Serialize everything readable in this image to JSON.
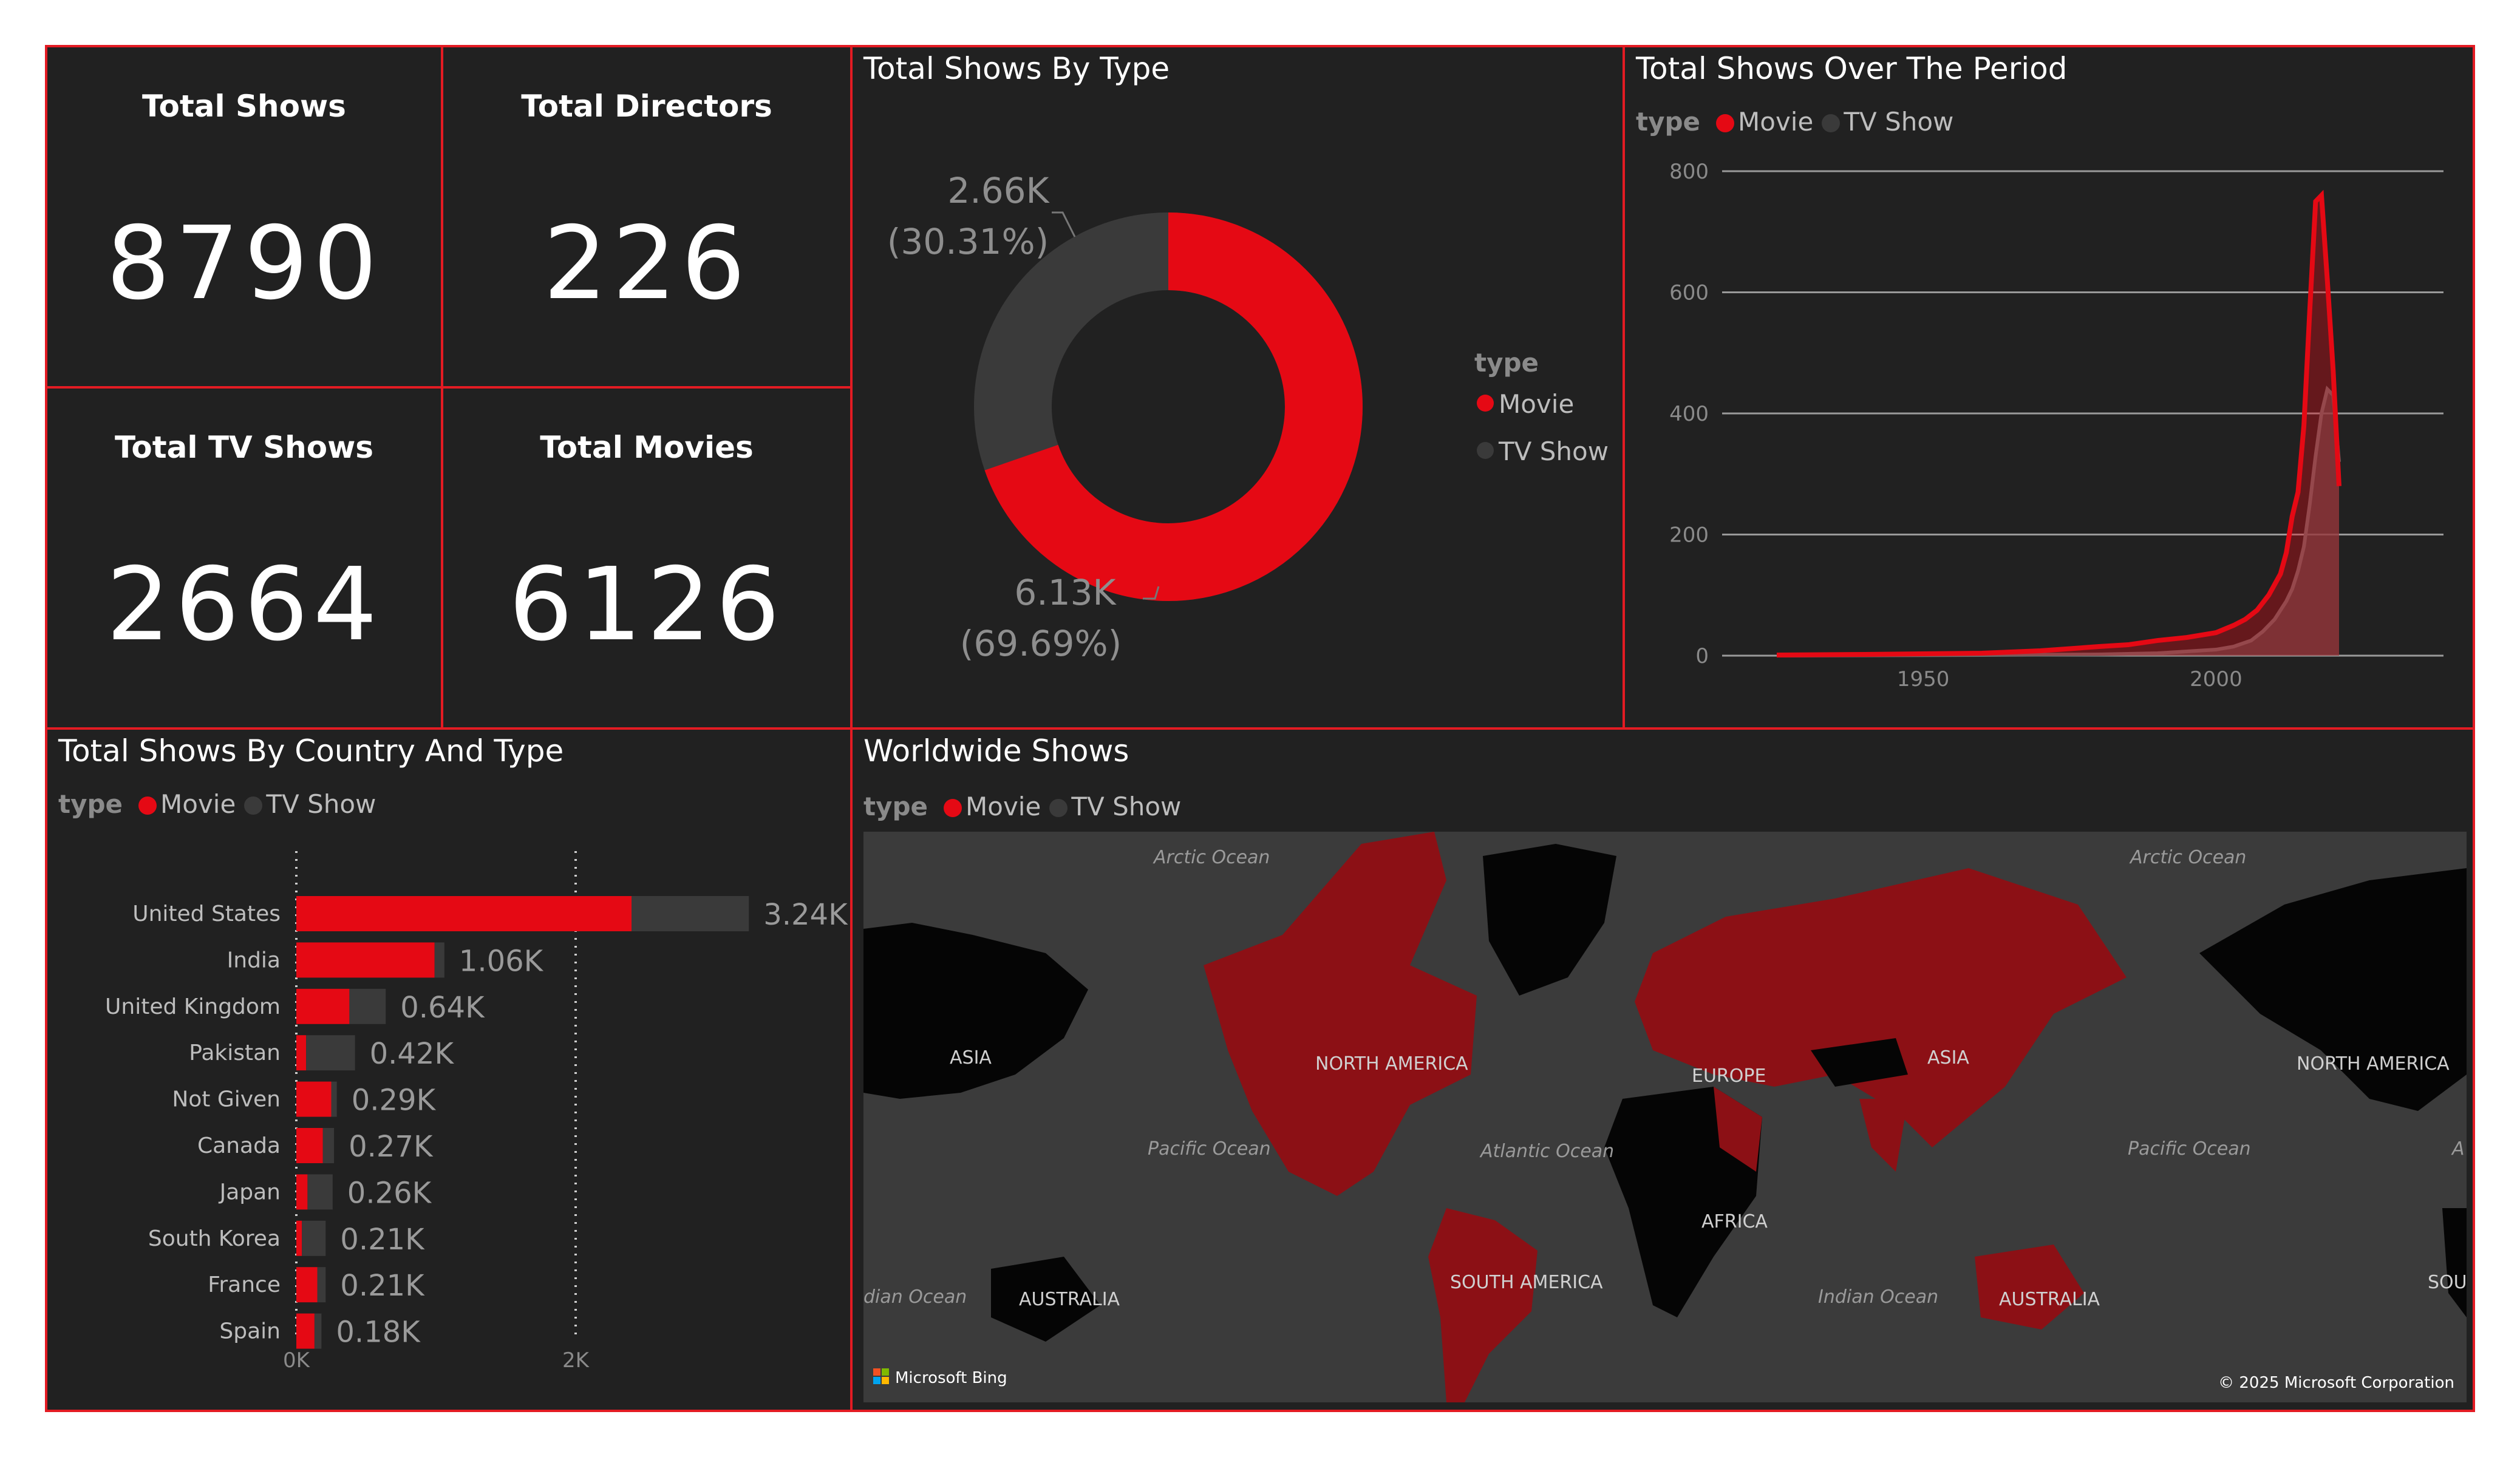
{
  "colors": {
    "movie": "#e50914",
    "tv_show": "#3a3a3a",
    "border": "#e31b23",
    "panel_bg": "#212121"
  },
  "kpis": {
    "total_shows": {
      "label": "Total Shows",
      "value": "8790"
    },
    "total_directors": {
      "label": "Total Directors",
      "value": "226"
    },
    "total_tv_shows": {
      "label": "Total TV Shows",
      "value": "2664"
    },
    "total_movies": {
      "label": "Total Movies",
      "value": "6126"
    }
  },
  "legend": {
    "title": "type",
    "movie": "Movie",
    "tv_show": "TV Show"
  },
  "donut": {
    "title": "Total Shows By Type",
    "tv_label": "2.66K",
    "tv_pct": "(30.31%)",
    "movie_label": "6.13K",
    "movie_pct": "(69.69%)"
  },
  "period": {
    "title": "Total Shows Over The Period"
  },
  "country": {
    "title": "Total Shows By Country And Type"
  },
  "map": {
    "title": "Worldwide Shows",
    "attribution": "Microsoft Bing",
    "copyright": "© 2025 Microsoft Corporation",
    "labels": {
      "arctic_left": "Arctic Ocean",
      "arctic_right": "Arctic Ocean",
      "asia_left": "ASIA",
      "north_america": "NORTH AMERICA",
      "europe": "EUROPE",
      "asia": "ASIA",
      "north_america_right": "NORTH AMERICA",
      "pacific_left": "Pacific Ocean",
      "atlantic": "Atlantic Ocean",
      "pacific_right": "Pacific Ocean",
      "africa": "AFRICA",
      "south_america": "SOUTH AMERICA",
      "australia_left": "AUSTRALIA",
      "australia": "AUSTRALIA",
      "indian": "Indian Ocean",
      "indian_left": "dian Ocean",
      "south_right": "SOUT",
      "edge_right": "A"
    }
  },
  "chart_data": [
    {
      "type": "pie",
      "title": "Total Shows By Type",
      "legend_title": "type",
      "legend_position": "right",
      "categories": [
        "Movie",
        "TV Show"
      ],
      "values": [
        6126,
        2664
      ],
      "data_labels": [
        "6.13K (69.69%)",
        "2.66K (30.31%)"
      ]
    },
    {
      "type": "area",
      "title": "Total Shows Over The Period",
      "legend_title": "type",
      "legend_position": "top-left",
      "xlim": [
        1925,
        2021
      ],
      "ylim": [
        0,
        800
      ],
      "x_ticks": [
        1950,
        2000
      ],
      "y_ticks": [
        0,
        200,
        400,
        600,
        800
      ],
      "grid": true,
      "series": [
        {
          "name": "Movie",
          "x": [
            1925,
            1940,
            1960,
            1970,
            1980,
            1985,
            1990,
            1995,
            2000,
            2003,
            2005,
            2007,
            2009,
            2011,
            2012,
            2013,
            2014,
            2015,
            2016,
            2017,
            2018,
            2019,
            2020,
            2021
          ],
          "y": [
            1,
            2,
            4,
            8,
            15,
            18,
            25,
            30,
            38,
            50,
            60,
            75,
            100,
            135,
            170,
            230,
            270,
            380,
            570,
            750,
            760,
            620,
            470,
            280
          ]
        },
        {
          "name": "TV Show",
          "x": [
            1925,
            1960,
            1980,
            1990,
            2000,
            2003,
            2006,
            2008,
            2010,
            2012,
            2013,
            2014,
            2015,
            2016,
            2017,
            2018,
            2019,
            2020,
            2021
          ],
          "y": [
            0,
            1,
            2,
            4,
            10,
            15,
            25,
            40,
            60,
            90,
            110,
            140,
            180,
            250,
            330,
            400,
            440,
            430,
            320
          ]
        }
      ]
    },
    {
      "type": "bar",
      "orientation": "horizontal",
      "stacked": true,
      "title": "Total Shows By Country And Type",
      "legend_title": "type",
      "legend_position": "top-left",
      "categories": [
        "United States",
        "India",
        "United Kingdom",
        "Pakistan",
        "Not Given",
        "Canada",
        "Japan",
        "South Korea",
        "France",
        "Spain"
      ],
      "series": [
        {
          "name": "Movie",
          "values": [
            2400,
            990,
            380,
            70,
            250,
            190,
            80,
            40,
            150,
            130
          ]
        },
        {
          "name": "TV Show",
          "values": [
            840,
            70,
            260,
            350,
            40,
            80,
            180,
            170,
            60,
            50
          ]
        }
      ],
      "totals": [
        "3.24K",
        "1.06K",
        "0.64K",
        "0.42K",
        "0.29K",
        "0.27K",
        "0.26K",
        "0.21K",
        "0.21K",
        "0.18K"
      ],
      "x_ticks": [
        "0K",
        "2K"
      ],
      "xlim": [
        0,
        4000
      ]
    }
  ]
}
